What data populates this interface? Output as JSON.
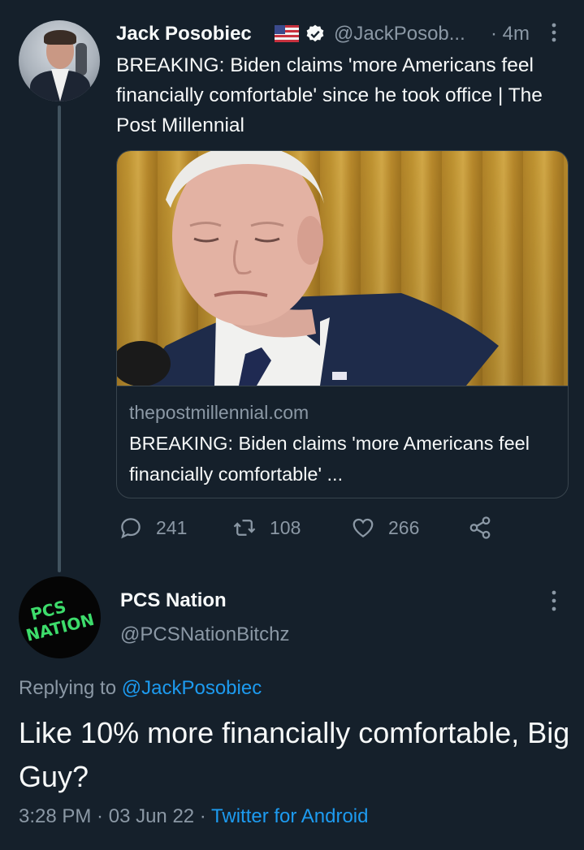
{
  "tweet": {
    "author_name": "Jack Posobiec",
    "author_handle": "@JackPosob...",
    "time_ago": "· 4m",
    "text": "BREAKING: Biden claims 'more Americans feel financially comfortable' since he took office | The Post Millennial",
    "card": {
      "domain": "thepostmillennial.com",
      "title": "BREAKING: Biden claims 'more Americans feel financially comfortable' ..."
    },
    "actions": {
      "replies": "241",
      "retweets": "108",
      "likes": "266"
    }
  },
  "reply": {
    "author_name": "PCS Nation",
    "author_handle": "@PCSNationBitchz",
    "avatar_text_1": "PCS",
    "avatar_text_2": "NATION",
    "replying_prefix": "Replying to ",
    "replying_to": "@JackPosobiec",
    "text": "Like 10% more financially comfortable, Big Guy?",
    "time": "3:28 PM",
    "date": "03 Jun 22",
    "source": "Twitter for Android",
    "separator": " · "
  },
  "icons": {
    "flag": "us-flag-icon",
    "verified": "verified-badge-icon",
    "more": "more-vertical-icon",
    "reply": "reply-icon",
    "retweet": "retweet-icon",
    "like": "heart-icon",
    "share": "share-icon"
  },
  "colors": {
    "background": "#15202b",
    "text_primary": "#f7f9f9",
    "text_secondary": "#8b98a5",
    "accent": "#1d9bf0",
    "border": "#38444d",
    "avatar_text": "#3ddc6b"
  }
}
